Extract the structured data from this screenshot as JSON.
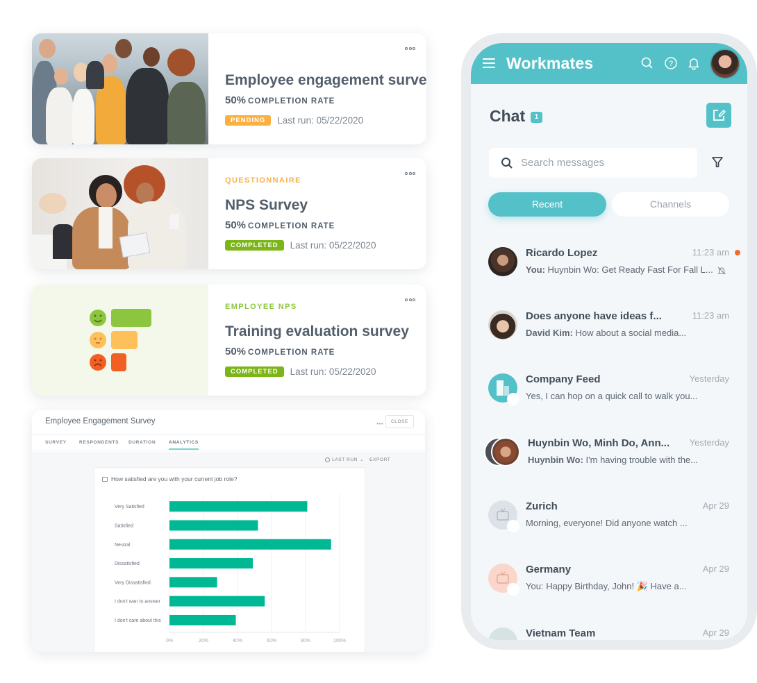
{
  "survey_cards": [
    {
      "category": "",
      "title": "Employee engagement survey",
      "completion_pct": "50%",
      "completion_label": "COMPLETION RATE",
      "status": "PENDING",
      "status_color": "#fbb040",
      "last_run": "Last run: 05/22/2020",
      "thumb": "team-photo"
    },
    {
      "category": "QUESTIONNAIRE",
      "category_color": "#f7b24a",
      "title": "NPS Survey",
      "completion_pct": "50%",
      "completion_label": "COMPLETION RATE",
      "status": "COMPLETED",
      "status_color": "#7cb518",
      "last_run": "Last run: 05/22/2020",
      "thumb": "coworkers-tablet-photo"
    },
    {
      "category": "EMPLOYEE NPS",
      "category_color": "#8cc63f",
      "title": "Training evaluation survey",
      "completion_pct": "50%",
      "completion_label": "COMPLETION RATE",
      "status": "COMPLETED",
      "status_color": "#7cb518",
      "last_run": "Last run: 05/22/2020",
      "thumb": "satisfaction-faces-illustration"
    }
  ],
  "analytics": {
    "title": "Employee Engagement Survey",
    "more_label": "•••",
    "close_label": "CLOSE",
    "tabs": [
      "SURVEY",
      "RESPONDENTS",
      "DURATION",
      "ANALYTICS"
    ],
    "active_tab": "ANALYTICS",
    "last_run_label": "LAST RUN",
    "export_label": "EXPORT",
    "question": "How satisfied are you with your current job role?"
  },
  "chart_data": {
    "type": "bar",
    "orientation": "horizontal",
    "title": "How satisfied are you with your current job role?",
    "categories": [
      "Very Satisfied",
      "Satisfied",
      "Neutral",
      "Dissatisfied",
      "Very Dissatisfied",
      "I don't wan to answer",
      "I don't care about this"
    ],
    "values": [
      81,
      52,
      95,
      49,
      28,
      56,
      39
    ],
    "xlim": [
      0,
      100
    ],
    "xticks": [
      "0%",
      "20%",
      "40%",
      "60%",
      "80%",
      "100%"
    ],
    "xlabel": "",
    "ylabel": "",
    "grid": true,
    "bar_color": "#00b893"
  },
  "chat_app": {
    "app_title": "Workmates",
    "header_title": "Chat",
    "unread_count": "1",
    "search_placeholder": "Search messages",
    "tabs": {
      "recent": "Recent",
      "channels": "Channels"
    },
    "active_tab": "Recent",
    "accent_color": "#54c1c9",
    "conversations": [
      {
        "name": "Ricardo Lopez",
        "time": "11:23 am",
        "sender": "You:",
        "message": "Huynbin Wo: Get Ready Fast For Fall L...",
        "unread": true,
        "muted": true,
        "avatar": "person-photo"
      },
      {
        "name": "Does anyone have ideas f...",
        "time": "11:23 am",
        "sender": "David Kim:",
        "message": "How about a social media...",
        "unread": false,
        "muted": false,
        "avatar": "person-photo"
      },
      {
        "name": "Company Feed",
        "time": "Yesterday",
        "sender": "",
        "message": "Yes, I can hop on a quick call to walk you...",
        "unread": false,
        "muted": false,
        "avatar": "building-icon"
      },
      {
        "name": "Huynbin Wo, Minh Do, Ann...",
        "time": "Yesterday",
        "sender": "Huynbin Wo:",
        "message": "I'm having trouble with the...",
        "unread": false,
        "muted": false,
        "avatar": "group-photo"
      },
      {
        "name": "Zurich",
        "time": "Apr 29",
        "sender": "",
        "message": "Morning, everyone! Did anyone watch ...",
        "unread": false,
        "muted": false,
        "avatar": "tv-icon"
      },
      {
        "name": "Germany",
        "time": "Apr 29",
        "sender": "You:",
        "message": "Happy Birthday, John! 🎉 Have a...",
        "unread": false,
        "muted": false,
        "avatar": "tv-icon"
      },
      {
        "name": "Vietnam Team",
        "time": "Apr 29",
        "sender": "",
        "message": "",
        "unread": false,
        "muted": false,
        "avatar": "tv-icon"
      }
    ]
  }
}
